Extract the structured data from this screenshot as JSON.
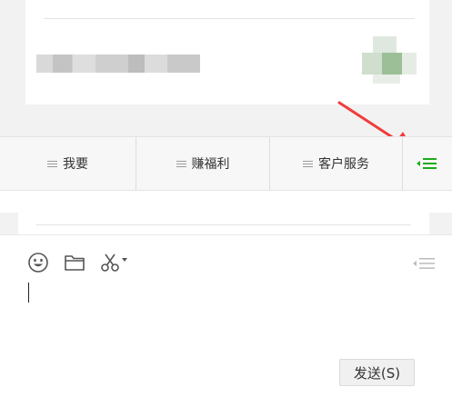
{
  "menu": {
    "items": [
      {
        "label": "我要"
      },
      {
        "label": "赚福利"
      },
      {
        "label": "客户服务"
      }
    ],
    "accent_color": "#1aad19",
    "switch_icon": "keyboard-switch-icon"
  },
  "annotation": {
    "arrow_color": "#f23c3c"
  },
  "input": {
    "toolbar_icons": [
      "emoji-icon",
      "folder-icon",
      "screenshot-scissors-icon",
      "dropdown-caret-icon"
    ],
    "switch_icon": "menu-switch-icon",
    "send_label": "发送(S)"
  }
}
